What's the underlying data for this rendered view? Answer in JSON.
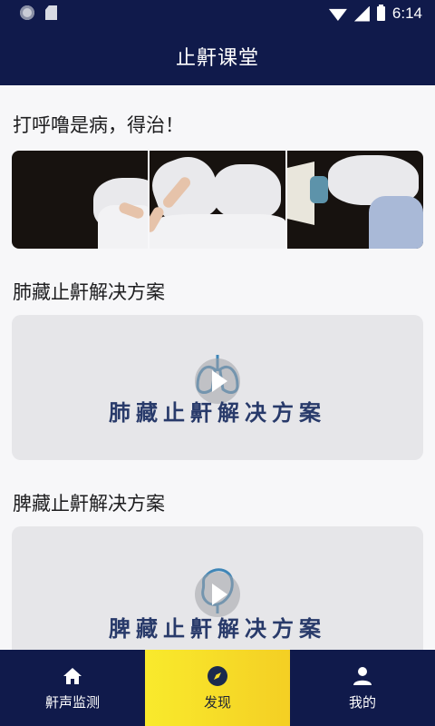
{
  "status_bar": {
    "time": "6:14"
  },
  "header": {
    "title": "止鼾课堂"
  },
  "sections": [
    {
      "title": "打呼噜是病，得治！"
    },
    {
      "title": "肺藏止鼾解决方案",
      "video_caption": "肺藏止鼾解决方案"
    },
    {
      "title": "脾藏止鼾解决方案",
      "video_caption": "脾藏止鼾解决方案"
    }
  ],
  "nav": [
    {
      "label": "鼾声监测",
      "icon": "home-icon"
    },
    {
      "label": "发现",
      "icon": "compass-icon",
      "active": true
    },
    {
      "label": "我的",
      "icon": "person-icon"
    }
  ],
  "colors": {
    "primary": "#101a4b",
    "active_tab": "#f7dd2a",
    "caption": "#283a6a"
  }
}
